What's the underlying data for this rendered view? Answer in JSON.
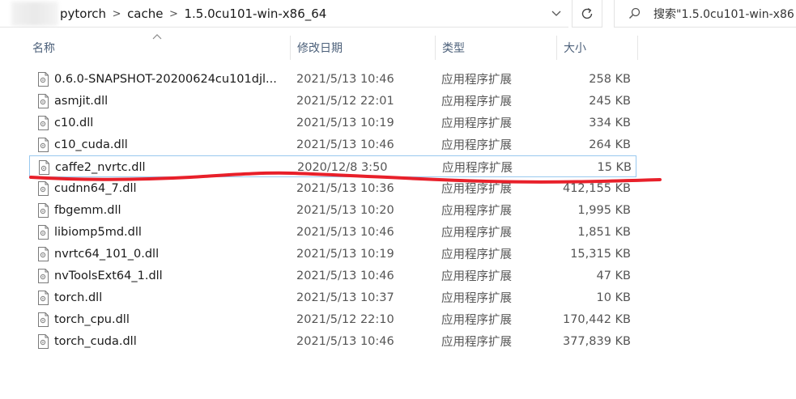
{
  "address_bar": {
    "breadcrumbs": [
      "pytorch",
      "cache",
      "1.5.0cu101-win-x86_64"
    ],
    "separator": ">",
    "dropdown_icon": "chevron-down-icon",
    "refresh_icon": "refresh-icon"
  },
  "search": {
    "icon": "search-icon",
    "text": "搜索\"1.5.0cu101-win-x86"
  },
  "columns": {
    "name": "名称",
    "date": "修改日期",
    "type": "类型",
    "size": "大小"
  },
  "files": [
    {
      "name": "0.6.0-SNAPSHOT-20200624cu101djl...",
      "date": "2021/5/13 10:46",
      "type": "应用程序扩展",
      "size": "258 KB"
    },
    {
      "name": "asmjit.dll",
      "date": "2021/5/12 22:01",
      "type": "应用程序扩展",
      "size": "245 KB"
    },
    {
      "name": "c10.dll",
      "date": "2021/5/13 10:19",
      "type": "应用程序扩展",
      "size": "334 KB"
    },
    {
      "name": "c10_cuda.dll",
      "date": "2021/5/13 10:46",
      "type": "应用程序扩展",
      "size": "264 KB"
    },
    {
      "name": "caffe2_nvrtc.dll",
      "date": "2020/12/8 3:50",
      "type": "应用程序扩展",
      "size": "15 KB",
      "selected": true
    },
    {
      "name": "cudnn64_7.dll",
      "date": "2021/5/13 10:36",
      "type": "应用程序扩展",
      "size": "412,155 KB"
    },
    {
      "name": "fbgemm.dll",
      "date": "2021/5/13 10:20",
      "type": "应用程序扩展",
      "size": "1,995 KB"
    },
    {
      "name": "libiomp5md.dll",
      "date": "2021/5/13 10:46",
      "type": "应用程序扩展",
      "size": "1,851 KB"
    },
    {
      "name": "nvrtc64_101_0.dll",
      "date": "2021/5/13 10:19",
      "type": "应用程序扩展",
      "size": "15,315 KB"
    },
    {
      "name": "nvToolsExt64_1.dll",
      "date": "2021/5/13 10:46",
      "type": "应用程序扩展",
      "size": "47 KB"
    },
    {
      "name": "torch.dll",
      "date": "2021/5/13 10:37",
      "type": "应用程序扩展",
      "size": "10 KB"
    },
    {
      "name": "torch_cpu.dll",
      "date": "2021/5/12 22:10",
      "type": "应用程序扩展",
      "size": "170,442 KB"
    },
    {
      "name": "torch_cuda.dll",
      "date": "2021/5/13 10:46",
      "type": "应用程序扩展",
      "size": "377,839 KB"
    }
  ],
  "colors": {
    "selection_border": "#99c9ef",
    "header_text": "#4c607a",
    "annotation": "#e8202a"
  }
}
